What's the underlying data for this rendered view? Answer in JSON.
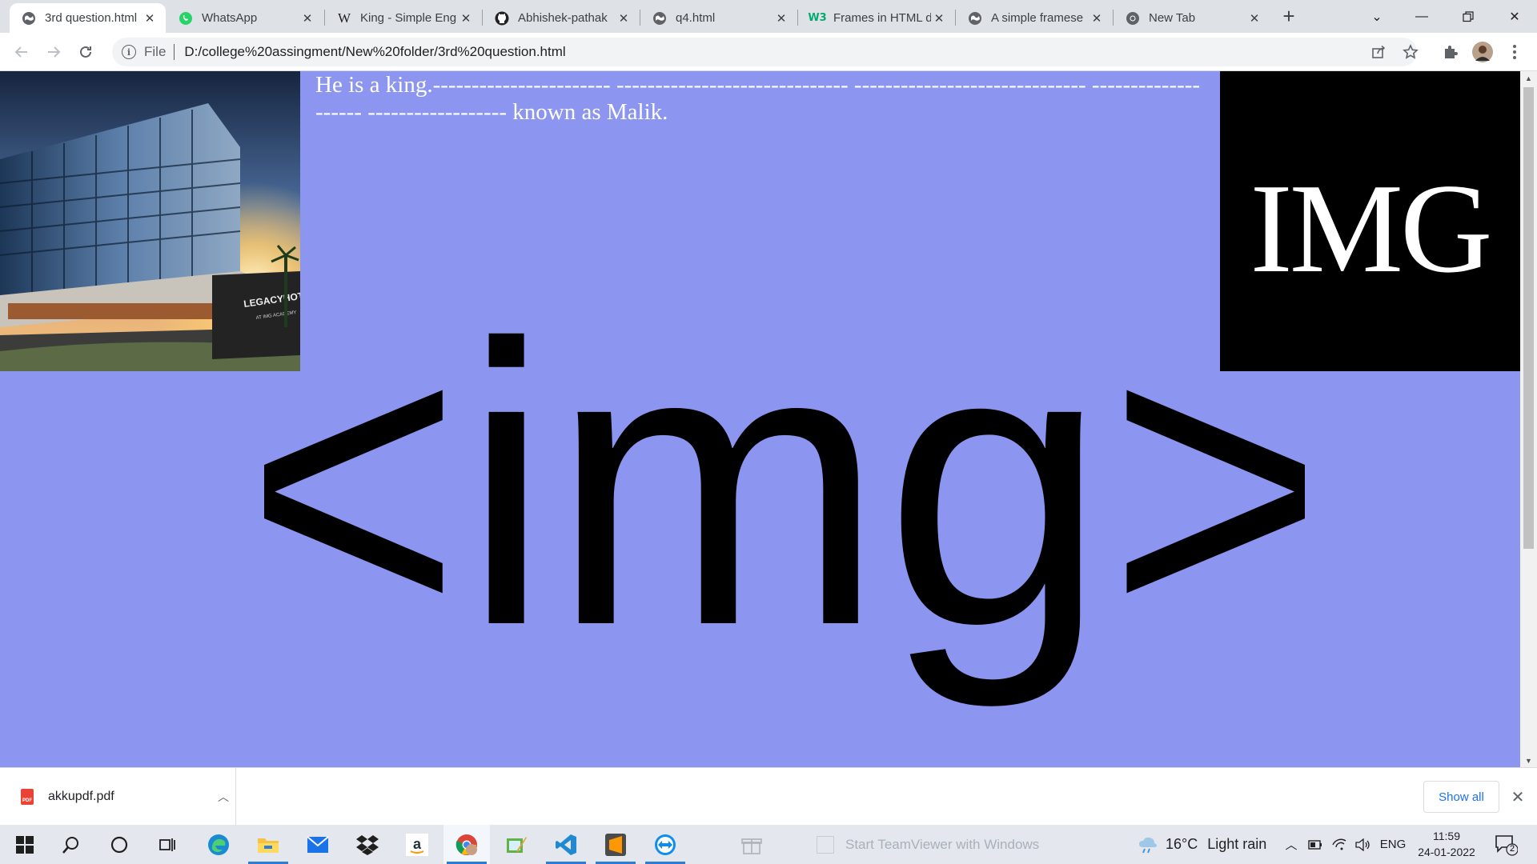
{
  "browser": {
    "tabs": [
      {
        "title": "3rd question.html",
        "favicon": "globe-icon",
        "active": true
      },
      {
        "title": "WhatsApp",
        "favicon": "whatsapp-icon",
        "active": false
      },
      {
        "title": "King - Simple Eng",
        "favicon": "wikipedia-icon",
        "active": false
      },
      {
        "title": "Abhishek-pathak",
        "favicon": "github-icon",
        "active": false
      },
      {
        "title": "q4.html",
        "favicon": "globe-icon",
        "active": false
      },
      {
        "title": "Frames in HTML d",
        "favicon": "w3schools-icon",
        "active": false
      },
      {
        "title": "A simple framese",
        "favicon": "globe-icon",
        "active": false
      },
      {
        "title": "New Tab",
        "favicon": "chrome-icon",
        "active": false
      }
    ],
    "new_tab_label": "+",
    "address": {
      "scheme": "File",
      "url": "D:/college%20assingment/New%20folder/3rd%20question.html"
    }
  },
  "page": {
    "text": "He is a king.----------------------- ------------------------------ ------------------------------ -------------------- ------------------ known as Malik.",
    "background": "#8c96f0",
    "left_frame_hotel_sign": "LEGACYHOTEL",
    "left_frame_hotel_sub": "AT IMG ACADEMY",
    "right_frame_logo": "IMG",
    "center_logo": "<img>"
  },
  "downloads": {
    "file_name": "akkupdf.pdf",
    "show_all_label": "Show all"
  },
  "taskbar": {
    "teamviewer_notice": "Start TeamViewer with Windows",
    "weather_temp": "16°C",
    "weather_desc": "Light rain",
    "language": "ENG",
    "time": "11:59",
    "date": "24-01-2022",
    "notification_count": "2"
  }
}
